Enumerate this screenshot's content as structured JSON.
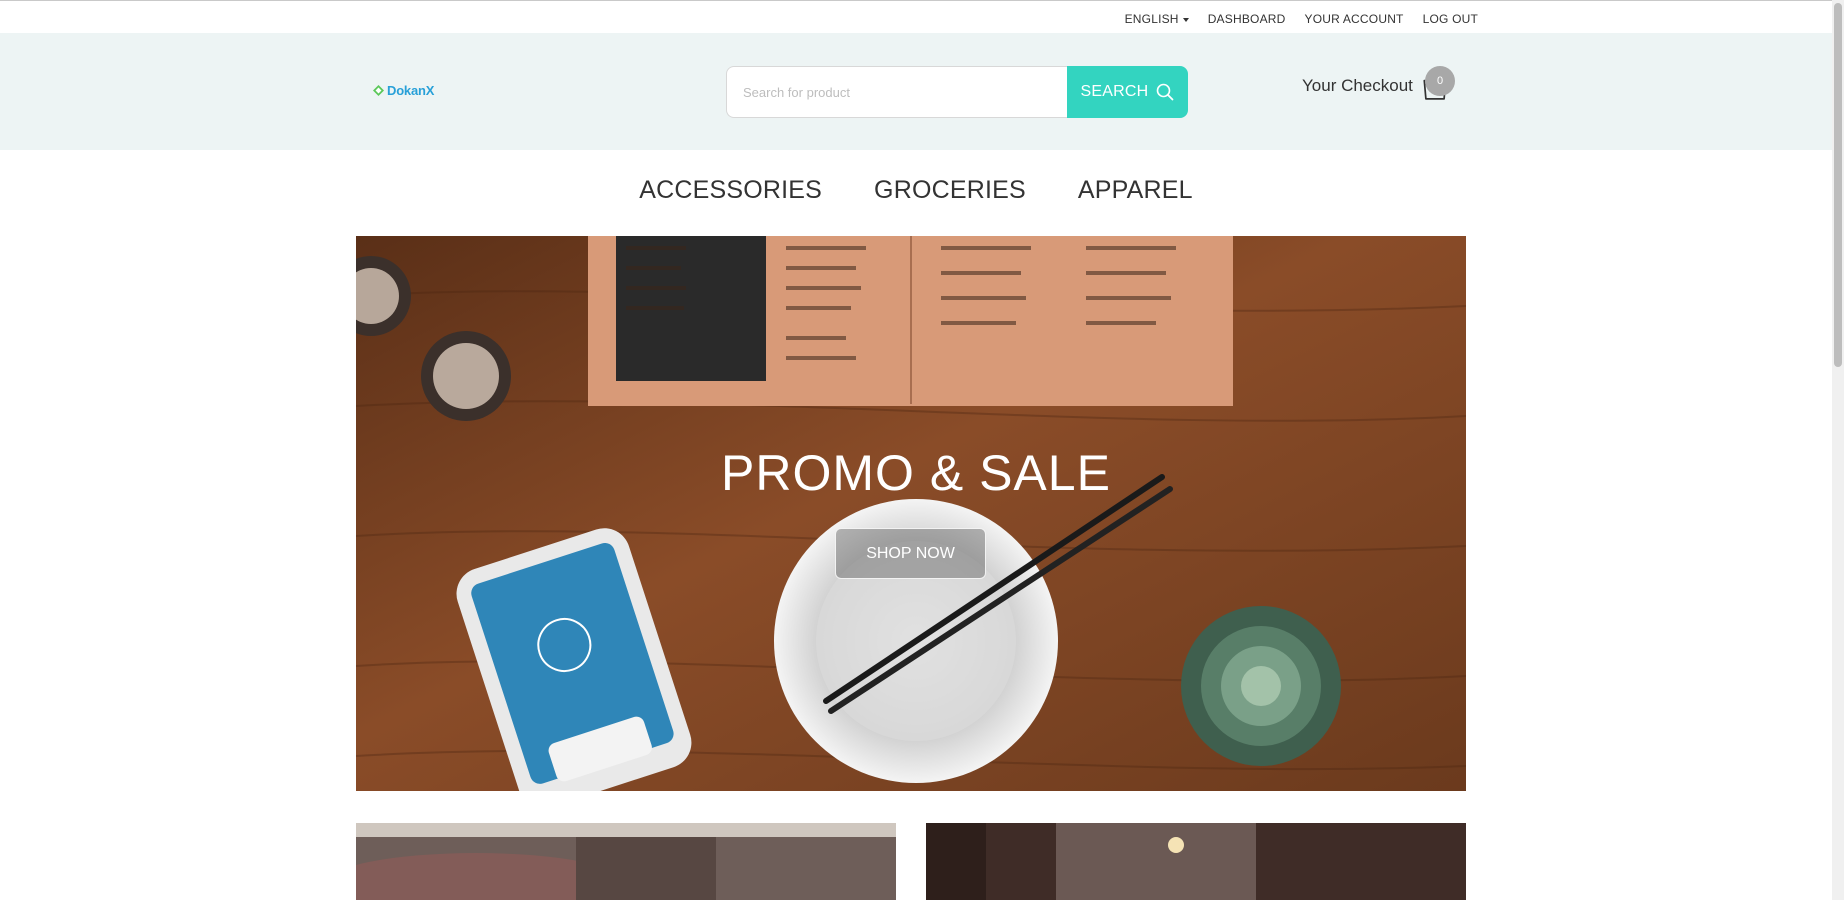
{
  "topbar": {
    "language": "ENGLISH",
    "dashboard": "DASHBOARD",
    "account": "YOUR ACCOUNT",
    "logout": "LOG OUT"
  },
  "header": {
    "logo_text": "DokanX",
    "search_placeholder": "Search for product",
    "search_button": "SEARCH",
    "checkout_label": "Your Checkout",
    "cart_count": "0"
  },
  "categories": [
    "ACCESSORIES",
    "GROCERIES",
    "APPAREL"
  ],
  "hero": {
    "title": "PROMO & SALE",
    "button": "SHOP NOW"
  },
  "colors": {
    "accent": "#33d4c0",
    "header_bg": "#edf4f4",
    "logo": "#28a0d8"
  }
}
